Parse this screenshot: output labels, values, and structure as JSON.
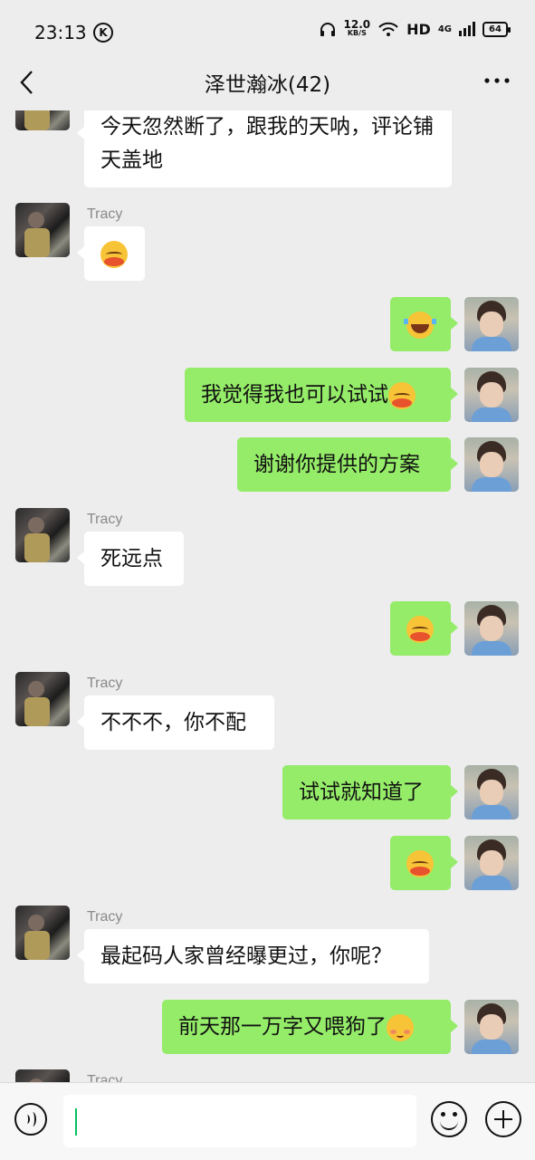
{
  "status": {
    "time": "23:13",
    "k_badge": "K",
    "speed_value": "12.0",
    "speed_unit": "KB/S",
    "hd": "HD",
    "network": "4G",
    "battery": "64"
  },
  "header": {
    "title": "泽世瀚冰(42)"
  },
  "messages": [
    {
      "side": "left",
      "text": "今天忽然断了，跟我的天呐，评论铺天盖地"
    },
    {
      "side": "left",
      "sender": "Tracy",
      "emoji": "blush-emoji"
    },
    {
      "side": "right",
      "emoji": "laugh-cry-emoji"
    },
    {
      "side": "right",
      "text": "我觉得我也可以试试",
      "emoji": "blush-emoji"
    },
    {
      "side": "right",
      "text": "谢谢你提供的方案"
    },
    {
      "side": "left",
      "sender": "Tracy",
      "text": "死远点"
    },
    {
      "side": "right",
      "emoji": "blush-emoji"
    },
    {
      "side": "left",
      "sender": "Tracy",
      "text": "不不不，你不配"
    },
    {
      "side": "right",
      "text": "试试就知道了"
    },
    {
      "side": "right",
      "emoji": "blush-emoji"
    },
    {
      "side": "left",
      "sender": "Tracy",
      "text": "最起码人家曾经曝更过，你呢？"
    },
    {
      "side": "right",
      "text": "前天那一万字又喂狗了",
      "emoji": "shy-emoji"
    },
    {
      "side": "left",
      "sender": "Tracy"
    }
  ],
  "colors": {
    "background": "#ededed",
    "my_bubble": "#95ec69",
    "their_bubble": "#ffffff",
    "cursor": "#07c160"
  }
}
